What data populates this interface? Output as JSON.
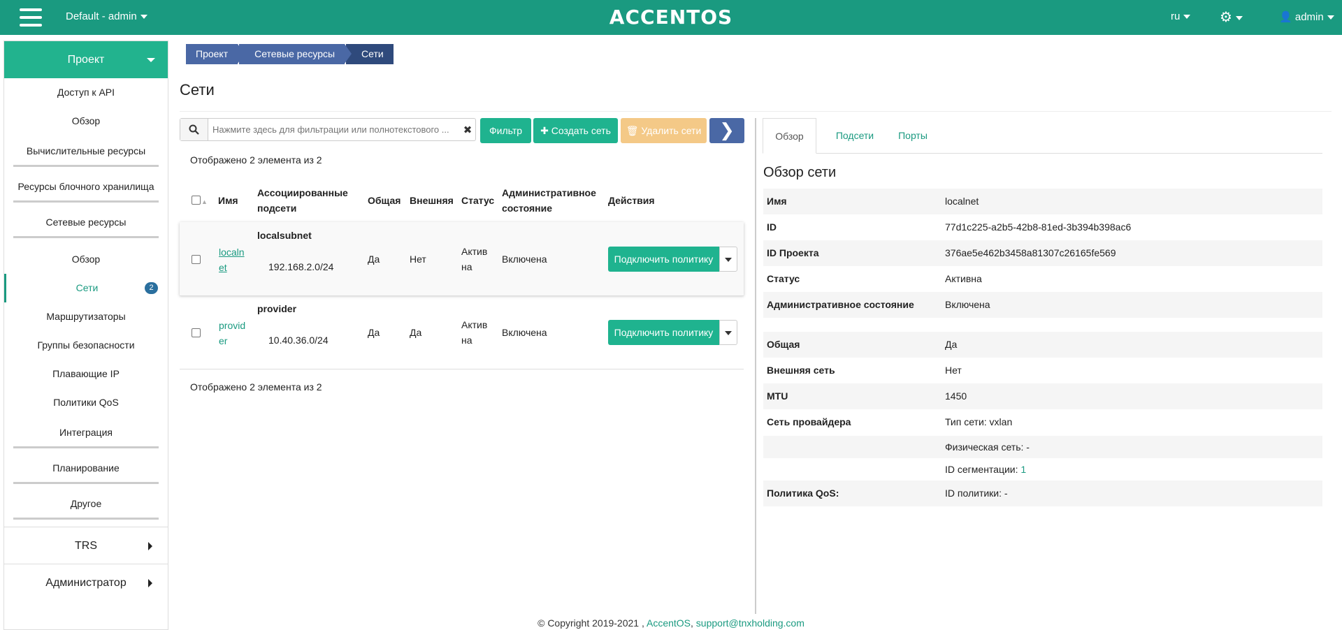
{
  "topbar": {
    "project": "Default - admin",
    "logo": "ACCENTOS",
    "lang": "ru",
    "user": "admin"
  },
  "sidebar": {
    "project_label": "Проект",
    "items": [
      "Доступ к API",
      "Обзор"
    ],
    "groups": [
      "Вычислительные ресурсы",
      "Ресурсы блочного хранилища",
      "Сетевые ресурсы"
    ],
    "network_items": [
      "Обзор",
      "Сети",
      "Маршрутизаторы",
      "Группы безопасности",
      "Плавающие IP",
      "Политики QoS"
    ],
    "network_badge": "2",
    "groups2": [
      "Интеграция",
      "Планирование",
      "Другое"
    ],
    "sections": [
      "TRS",
      "Администратор"
    ]
  },
  "breadcrumb": [
    "Проект",
    "Сетевые ресурсы",
    "Сети"
  ],
  "page_title": "Сети",
  "toolbar": {
    "search_placeholder": "Нажмите здесь для фильтрации или полнотекстового ...",
    "filter": "Фильтр",
    "create": "Создать сеть",
    "delete": "Удалить сети"
  },
  "count_text": "Отображено 2 элемента из 2",
  "table": {
    "headers": {
      "name": "Имя",
      "subnets_1": "Ассоциированные",
      "subnets_2": "подсети",
      "shared": "Общая",
      "external": "Внешняя",
      "status": "Статус",
      "admin_1": "Административное",
      "admin_2": "состояние",
      "actions": "Действия"
    },
    "rows": [
      {
        "name_1": "localn",
        "name_2": "et",
        "subnet_name": "localsubnet",
        "subnet_cidr": "192.168.2.0/24",
        "shared": "Да",
        "external": "Нет",
        "status_1": "Актив",
        "status_2": "на",
        "admin": "Включена",
        "action": "Подключить политику"
      },
      {
        "name_1": "provid",
        "name_2": "er",
        "subnet_name": "provider",
        "subnet_cidr": "10.40.36.0/24",
        "shared": "Да",
        "external": "Да",
        "status_1": "Актив",
        "status_2": "на",
        "admin": "Включена",
        "action": "Подключить политику"
      }
    ]
  },
  "detail": {
    "tabs": [
      "Обзор",
      "Подсети",
      "Порты"
    ],
    "title": "Обзор сети",
    "fields": {
      "name_label": "Имя",
      "name": "localnet",
      "id_label": "ID",
      "id": "77d1c225-a2b5-42b8-81ed-3b394b398ac6",
      "project_label": "ID Проекта",
      "project": "376ae5e462b3458a81307c26165fe569",
      "status_label": "Статус",
      "status": "Активна",
      "admin_label": "Административное состояние",
      "admin": "Включена",
      "shared_label": "Общая",
      "shared": "Да",
      "external_label": "Внешняя сеть",
      "external": "Нет",
      "mtu_label": "MTU",
      "mtu": "1450",
      "provider_label": "Сеть провайдера",
      "net_type": "Тип сети: vxlan",
      "physnet": "Физическая сеть: -",
      "seg_prefix": "ID сегментации: ",
      "seg_id": "1",
      "qos_label": "Политика QoS:",
      "qos": "ID политики: -"
    }
  },
  "footer": {
    "copyright": "© Copyright 2019-2021 ,",
    "brand": "AccentOS",
    "email": "support@tnxholding.com"
  }
}
